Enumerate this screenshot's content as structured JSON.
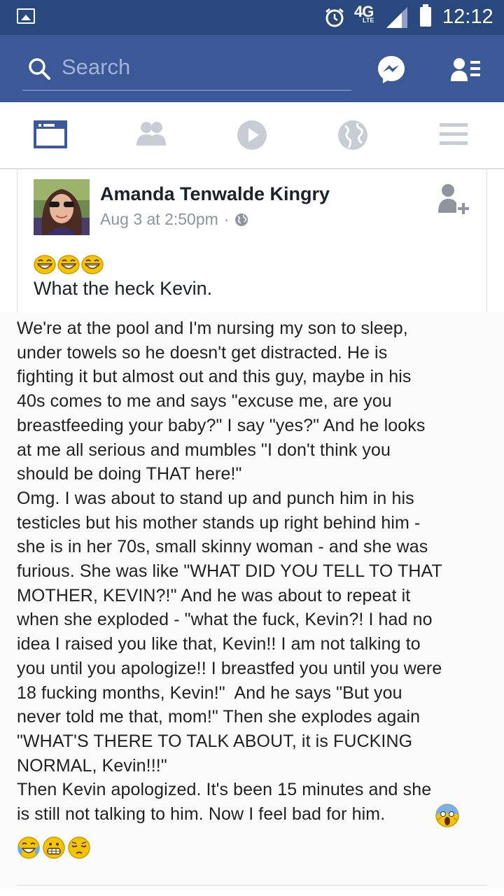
{
  "status_bar": {
    "time": "12:12",
    "network": "4G",
    "network_sub": "LTE"
  },
  "search": {
    "placeholder": "Search"
  },
  "nav": {
    "tabs": [
      "news-feed",
      "friends",
      "video",
      "notifications",
      "menu"
    ],
    "active": "news-feed"
  },
  "post": {
    "author": "Amanda Tenwalde Kingry",
    "timestamp": "Aug 3 at 2:50pm",
    "separator": "·",
    "privacy": "public-globe-icon",
    "title": "What the heck Kevin.",
    "body": "We're at the pool and I'm nursing my son to sleep,\nunder towels so he doesn't get distracted. He is\nfighting it but almost out and this guy, maybe in his\n40s comes to me and says \"excuse me, are you\nbreastfeeding your baby?\" I say \"yes?\" And he looks\nat me all serious and mumbles \"I don't think you\nshould be doing THAT here!\"\nOmg. I was about to stand up and punch him in his\ntesticles but his mother stands up right behind him -\nshe is in her 70s, small skinny woman - and she was\nfurious. She was like \"WHAT DID YOU TELL TO THAT\nMOTHER, KEVIN?!\" And he was about to repeat it\nwhen she exploded - \"what the fuck, Kevin?! I had no\nidea I raised you like that, Kevin!! I am not talking to\nyou until you apologize!! I breastfed you until you were\n18 fucking months, Kevin!\"  And he says \"But you\nnever told me that, mom!\" Then she explodes again\n\"WHAT'S THERE TO TALK ABOUT, it is FUCKING\nNORMAL, Kevin!!!\"\nThen Kevin apologized. It's been 15 minutes and she\nis still not talking to him. Now I feel bad for him.",
    "emojis_top": [
      "grinning-emoji",
      "grinning-emoji",
      "grinning-emoji"
    ],
    "emojis_bottom": [
      "tears-of-joy-emoji",
      "grimacing-emoji",
      "pensive-emoji"
    ],
    "trailing_emoji": "screaming-emoji"
  },
  "colors": {
    "status_bar": "#29487d",
    "header": "#3b5998",
    "nav_active": "#3b5998",
    "nav_inactive": "#c8ccd4"
  }
}
